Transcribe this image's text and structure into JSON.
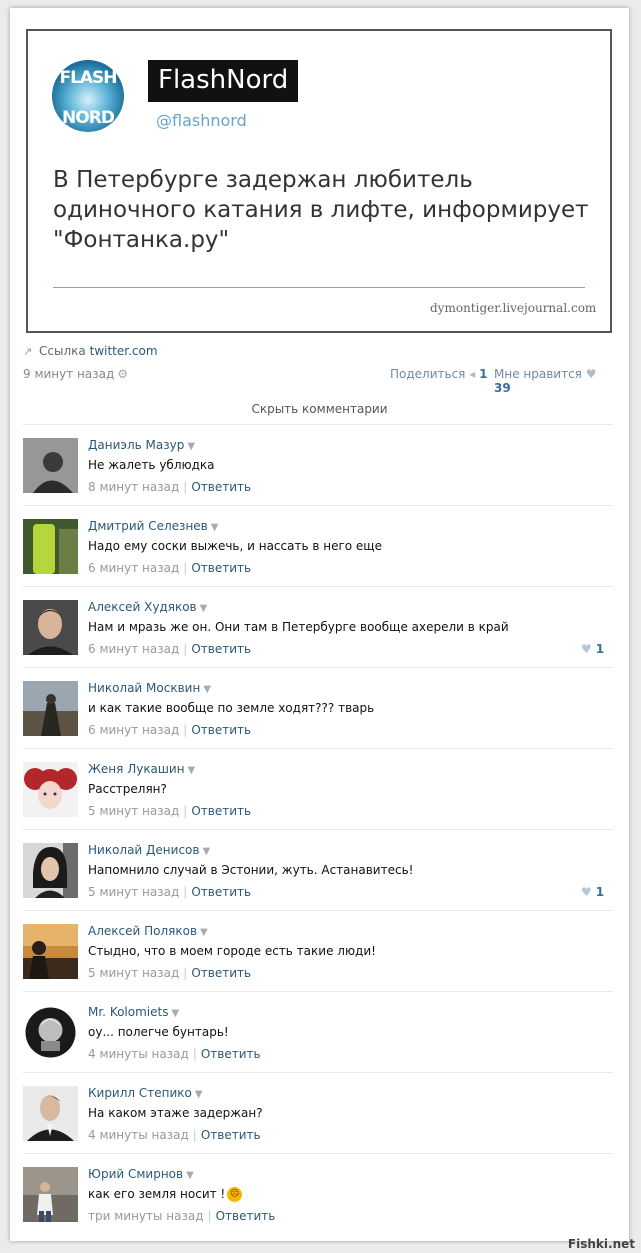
{
  "tweet": {
    "avatar_text_top": "FLASH",
    "avatar_text_bottom": "NORD",
    "name": "FlashNord",
    "handle": "@flashnord",
    "text": "В Петербурге задержан любитель одиночного катания в лифте, информирует \"Фонтанка.ру\"",
    "source": "dymontiger.livejournal.com"
  },
  "link": {
    "prefix": "Ссылка",
    "url": "twitter.com"
  },
  "meta": {
    "time": "9 минут назад",
    "share_label": "Поделиться",
    "share_count": "1",
    "like_label": "Мне нравится",
    "like_count": "39"
  },
  "hide_comments": "Скрыть комментарии",
  "comments": [
    {
      "name": "Даниэль Мазур",
      "text": "Не жалеть ублюдка",
      "time": "8 минут назад",
      "reply": "Ответить",
      "likes": ""
    },
    {
      "name": "Дмитрий Селезнев",
      "text": "Надо ему соски выжечь, и нассать в него еще",
      "time": "6 минут назад",
      "reply": "Ответить",
      "likes": ""
    },
    {
      "name": "Алексей Худяков",
      "text": "Нам и мразь же он. Они там в Петербурге вообще ахерели в край",
      "time": "6 минут назад",
      "reply": "Ответить",
      "likes": "1"
    },
    {
      "name": "Николай Москвин",
      "text": "и как такие вообще по земле ходят??? тварь",
      "time": "6 минут назад",
      "reply": "Ответить",
      "likes": ""
    },
    {
      "name": "Женя Лукашин",
      "text": "Расстрелян?",
      "time": "5 минут назад",
      "reply": "Ответить",
      "likes": ""
    },
    {
      "name": "Николай Денисов",
      "text": "Напомнило случай в Эстонии, жуть. Астанавитесь!",
      "time": "5 минут назад",
      "reply": "Ответить",
      "likes": "1"
    },
    {
      "name": "Алексей Поляков",
      "text": "Стыдно, что в моем городе есть такие люди!",
      "time": "5 минут назад",
      "reply": "Ответить",
      "likes": ""
    },
    {
      "name": "Mr. Kolomiets",
      "text": "оу... полегче бунтарь!",
      "time": "4 минуты назад",
      "reply": "Ответить",
      "likes": ""
    },
    {
      "name": "Кирилл Степико",
      "text": "На каком этаже задержан?",
      "time": "4 минуты назад",
      "reply": "Ответить",
      "likes": ""
    },
    {
      "name": "Юрий Смирнов",
      "text": "как его земля носит !",
      "time": "три минуты назад",
      "reply": "Ответить",
      "likes": ""
    }
  ],
  "watermark": "Fishki.net",
  "icons": {
    "link": "link-icon",
    "gear": "gear-icon",
    "share": "megaphone-icon",
    "like": "heart-icon",
    "comment_menu": "dropdown-arrow-icon",
    "emoji": "angry-face-icon"
  },
  "colors": {
    "link_blue": "#2b587a",
    "count_blue": "#3a6e9c",
    "handle_blue": "#6aa3c9"
  }
}
